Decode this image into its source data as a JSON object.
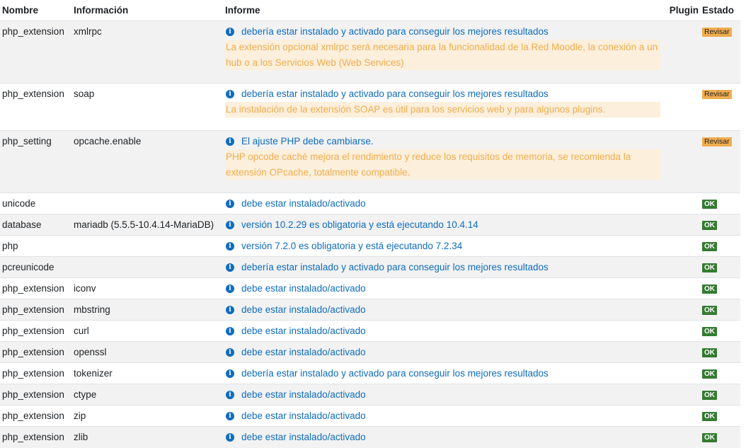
{
  "headers": {
    "name": "Nombre",
    "info": "Información",
    "report": "Informe",
    "plugin": "Plugin",
    "status": "Estado"
  },
  "colors": {
    "link": "#0f6cbf",
    "warning": "#f0ad4e",
    "warning_bg": "#fcefdc",
    "ok": "#357a32"
  },
  "icon": "info-circle-icon",
  "rows": [
    {
      "name": "php_extension",
      "info": "xmlrpc",
      "report": "debería estar instalado y activado para conseguir los mejores resultados",
      "detail": "La extensión opcional xmlrpc será necesaria para la funcionalidad de la Red Moodle, la conexión a un hub o a los Servicios Web (Web Services)",
      "plugin": "",
      "status": "Revisar",
      "status_type": "warn"
    },
    {
      "name": "php_extension",
      "info": "soap",
      "report": "debería estar instalado y activado para conseguir los mejores resultados",
      "detail": "La instalación de la extensión SOAP es útil para los servicios web y para algunos plugins.",
      "plugin": "",
      "status": "Revisar",
      "status_type": "warn"
    },
    {
      "name": "php_setting",
      "info": "opcache.enable",
      "report": "El ajuste PHP debe cambiarse.",
      "detail": "PHP opcode caché mejora el rendimiento y reduce los requisitos de memoria, se recomienda la extensión OPcache, totalmente compatible.",
      "plugin": "",
      "status": "Revisar",
      "status_type": "warn"
    },
    {
      "name": "unicode",
      "info": "",
      "report": "debe estar instalado/activado",
      "detail": "",
      "plugin": "",
      "status": "OK",
      "status_type": "ok"
    },
    {
      "name": "database",
      "info": "mariadb (5.5.5-10.4.14-MariaDB)",
      "report": "versión 10.2.29 es obligatoria y está ejecutando 10.4.14",
      "detail": "",
      "plugin": "",
      "status": "OK",
      "status_type": "ok"
    },
    {
      "name": "php",
      "info": "",
      "report": "versión 7.2.0 es obligatoria y está ejecutando 7.2.34",
      "detail": "",
      "plugin": "",
      "status": "OK",
      "status_type": "ok"
    },
    {
      "name": "pcreunicode",
      "info": "",
      "report": "debería estar instalado y activado para conseguir los mejores resultados",
      "detail": "",
      "plugin": "",
      "status": "OK",
      "status_type": "ok"
    },
    {
      "name": "php_extension",
      "info": "iconv",
      "report": "debe estar instalado/activado",
      "detail": "",
      "plugin": "",
      "status": "OK",
      "status_type": "ok"
    },
    {
      "name": "php_extension",
      "info": "mbstring",
      "report": "debe estar instalado/activado",
      "detail": "",
      "plugin": "",
      "status": "OK",
      "status_type": "ok"
    },
    {
      "name": "php_extension",
      "info": "curl",
      "report": "debe estar instalado/activado",
      "detail": "",
      "plugin": "",
      "status": "OK",
      "status_type": "ok"
    },
    {
      "name": "php_extension",
      "info": "openssl",
      "report": "debe estar instalado/activado",
      "detail": "",
      "plugin": "",
      "status": "OK",
      "status_type": "ok"
    },
    {
      "name": "php_extension",
      "info": "tokenizer",
      "report": "debería estar instalado y activado para conseguir los mejores resultados",
      "detail": "",
      "plugin": "",
      "status": "OK",
      "status_type": "ok"
    },
    {
      "name": "php_extension",
      "info": "ctype",
      "report": "debe estar instalado/activado",
      "detail": "",
      "plugin": "",
      "status": "OK",
      "status_type": "ok"
    },
    {
      "name": "php_extension",
      "info": "zip",
      "report": "debe estar instalado/activado",
      "detail": "",
      "plugin": "",
      "status": "OK",
      "status_type": "ok"
    },
    {
      "name": "php_extension",
      "info": "zlib",
      "report": "debe estar instalado/activado",
      "detail": "",
      "plugin": "",
      "status": "OK",
      "status_type": "ok"
    }
  ]
}
